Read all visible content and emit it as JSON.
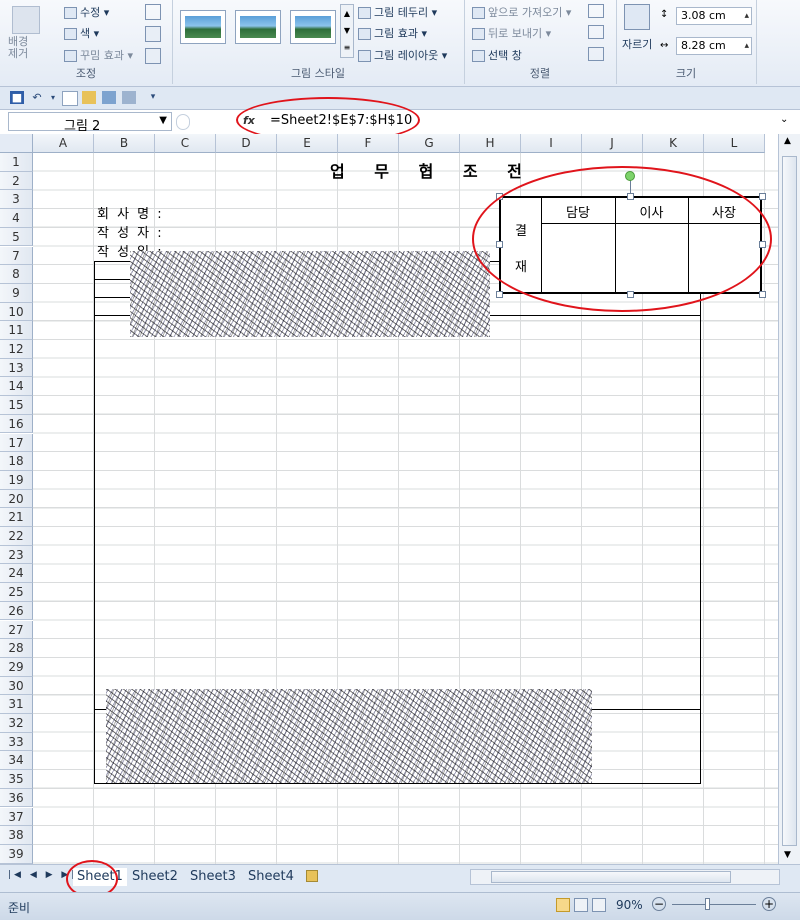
{
  "ribbon": {
    "adjust": {
      "title": "조정",
      "remove_bg": "배경\n제거",
      "correct": "수정",
      "color": "색",
      "artistic": "꾸밈 효과"
    },
    "styles": {
      "title": "그림 스타일",
      "border": "그림 테두리",
      "effects": "그림 효과",
      "layout": "그림 레이아웃"
    },
    "arrange": {
      "title": "정렬",
      "forward": "앞으로 가져오기",
      "backward": "뒤로 보내기",
      "selection": "선택 창"
    },
    "size": {
      "title": "크기",
      "crop": "자르기",
      "height": "3.08 cm",
      "width": "8.28 cm"
    }
  },
  "formula_bar": {
    "name_box": "그림 2",
    "fx": "fx",
    "formula": "=Sheet2!$E$7:$H$10"
  },
  "columns": [
    "A",
    "B",
    "C",
    "D",
    "E",
    "F",
    "G",
    "H",
    "I",
    "J",
    "K",
    "L"
  ],
  "rows": [
    "1",
    "2",
    "3",
    "4",
    "5",
    "7",
    "8",
    "9",
    "10",
    "11",
    "12",
    "13",
    "14",
    "15",
    "16",
    "17",
    "18",
    "19",
    "20",
    "21",
    "22",
    "23",
    "24",
    "25",
    "26",
    "27",
    "28",
    "29",
    "30",
    "31",
    "32",
    "33",
    "34",
    "35",
    "36",
    "37",
    "38",
    "39"
  ],
  "sheet": {
    "title": "업 무 협 조 전",
    "company_label": "회 사 명 :",
    "author_label": "작 성 자 :",
    "date_label": "작 성 일 :"
  },
  "approval": {
    "side_top": "결",
    "side_bottom": "재",
    "col1": "담당",
    "col2": "이사",
    "col3": "사장"
  },
  "tabs": [
    "Sheet1",
    "Sheet2",
    "Sheet3",
    "Sheet4"
  ],
  "status": {
    "ready": "준비",
    "zoom": "90%"
  }
}
